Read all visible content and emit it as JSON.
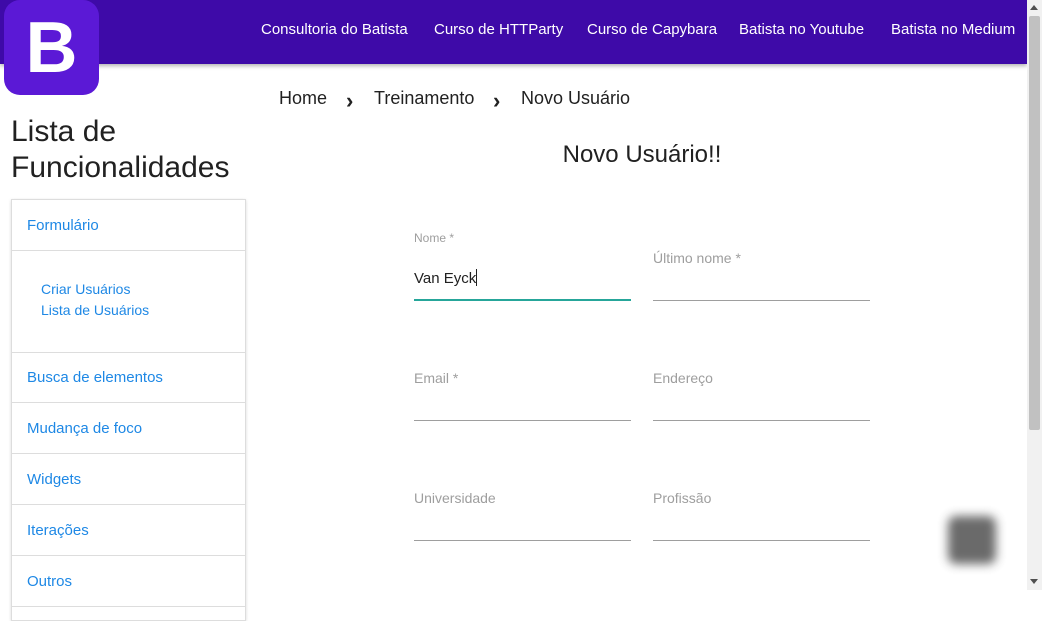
{
  "logo": {
    "letter": "B"
  },
  "nav": {
    "links": [
      "Consultoria do Batista",
      "Curso de HTTParty",
      "Curso de Capybara",
      "Batista no Youtube",
      "Batista no Medium"
    ]
  },
  "sidebar": {
    "title": "Lista de Funcionalidades",
    "items": {
      "formulario": "Formulário",
      "criar_usuarios": "Criar Usuários",
      "lista_usuarios": "Lista de Usuários",
      "busca": "Busca de elementos",
      "mudanca_foco": "Mudança de foco",
      "widgets": "Widgets",
      "iteracoes": "Iterações",
      "outros": "Outros"
    }
  },
  "breadcrumb": {
    "items": [
      "Home",
      "Treinamento",
      "Novo Usuário"
    ],
    "separator": "›"
  },
  "page": {
    "heading": "Novo Usuário!!"
  },
  "form": {
    "nome": {
      "label": "Nome *",
      "value": "Van Eyck"
    },
    "ultimo_nome": {
      "label": "Último nome *",
      "value": ""
    },
    "email": {
      "label": "Email *",
      "value": ""
    },
    "endereco": {
      "label": "Endereço",
      "value": ""
    },
    "universidade": {
      "label": "Universidade",
      "value": ""
    },
    "profissao": {
      "label": "Profissão",
      "value": ""
    }
  },
  "colors": {
    "navbar": "#3e0aa8",
    "logo": "#5b19d6",
    "link": "#1e88e5",
    "focus_underline": "#26a69a"
  }
}
